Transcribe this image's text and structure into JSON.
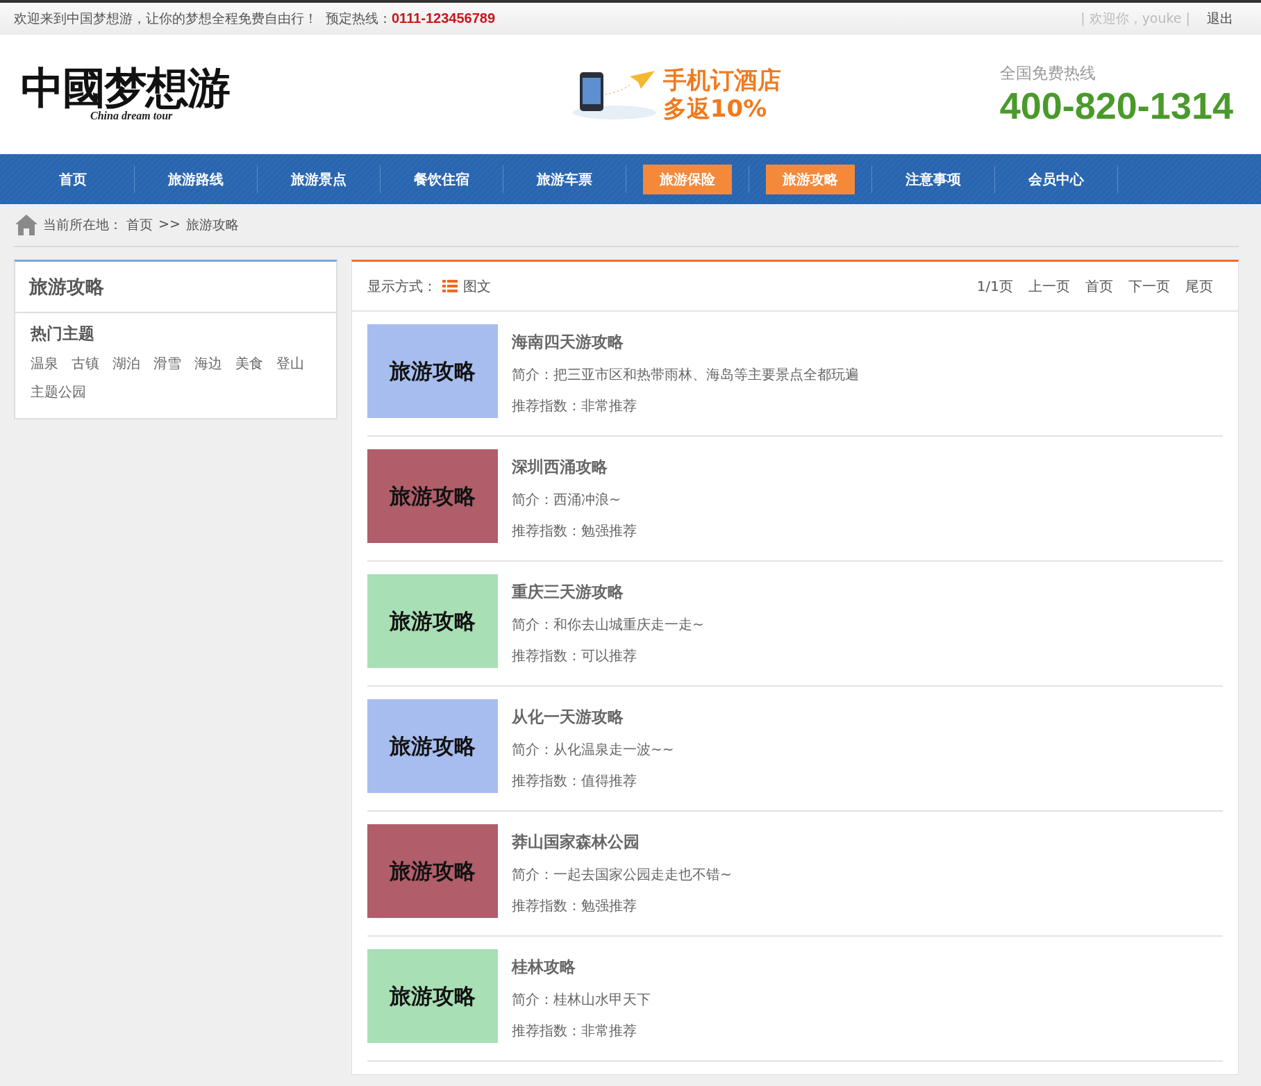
{
  "top_bar": {
    "welcome": "欢迎来到中国梦想游，让你的梦想全程免费自由行！",
    "hotline_label": "预定热线：",
    "hotline": "0111-123456789",
    "user_greeting": "| 欢迎你，youke |",
    "logout": "退出"
  },
  "header": {
    "logo_text": "中國梦想游",
    "logo_subtitle": "China dream tour",
    "promo_line1": "手机订酒店",
    "promo_line2": "多返10%",
    "hotline_label": "全国免费热线",
    "hotline": "400-820-1314"
  },
  "nav": [
    {
      "label": "首页",
      "selected": false
    },
    {
      "label": "旅游路线",
      "selected": false
    },
    {
      "label": "旅游景点",
      "selected": false
    },
    {
      "label": "餐饮住宿",
      "selected": false
    },
    {
      "label": "旅游车票",
      "selected": false
    },
    {
      "label": "旅游保险",
      "selected": true
    },
    {
      "label": "旅游攻略",
      "selected": true
    },
    {
      "label": "注意事项",
      "selected": false
    },
    {
      "label": "会员中心",
      "selected": false
    }
  ],
  "breadcrumb": {
    "label": "当前所在地：",
    "items": [
      "首页",
      ">>",
      "旅游攻略"
    ]
  },
  "sidebar": {
    "title": "旅游攻略",
    "section_title": "热门主题",
    "tags": [
      "温泉",
      "古镇",
      "湖泊",
      "滑雪",
      "海边",
      "美食",
      "登山",
      "主题公园"
    ]
  },
  "list_toolbar": {
    "display_label": "显示方式：",
    "display_mode": "图文",
    "pagination": [
      "1/1页",
      "上一页",
      "首页",
      "下一页",
      "尾页"
    ]
  },
  "articles": [
    {
      "thumb_text": "旅游攻略",
      "color": "#a7bdef",
      "title": "海南四天游攻略",
      "summary": "简介：把三亚市区和热带雨林、海岛等主要景点全都玩遍",
      "rating": "推荐指数：非常推荐"
    },
    {
      "thumb_text": "旅游攻略",
      "color": "#b05e6a",
      "title": "深圳西涌攻略",
      "summary": "简介：西涌冲浪~",
      "rating": "推荐指数：勉强推荐"
    },
    {
      "thumb_text": "旅游攻略",
      "color": "#a8dfb5",
      "title": "重庆三天游攻略",
      "summary": "简介：和你去山城重庆走一走~",
      "rating": "推荐指数：可以推荐"
    },
    {
      "thumb_text": "旅游攻略",
      "color": "#a7bdef",
      "title": "从化一天游攻略",
      "summary": "简介：从化温泉走一波~~",
      "rating": "推荐指数：值得推荐"
    },
    {
      "thumb_text": "旅游攻略",
      "color": "#b05e6a",
      "title": "莽山国家森林公园",
      "summary": "简介：一起去国家公园走走也不错~",
      "rating": "推荐指数：勉强推荐"
    },
    {
      "thumb_text": "旅游攻略",
      "color": "#a8dfb5",
      "title": "桂林攻略",
      "summary": "简介：桂林山水甲天下",
      "rating": "推荐指数：非常推荐"
    }
  ]
}
